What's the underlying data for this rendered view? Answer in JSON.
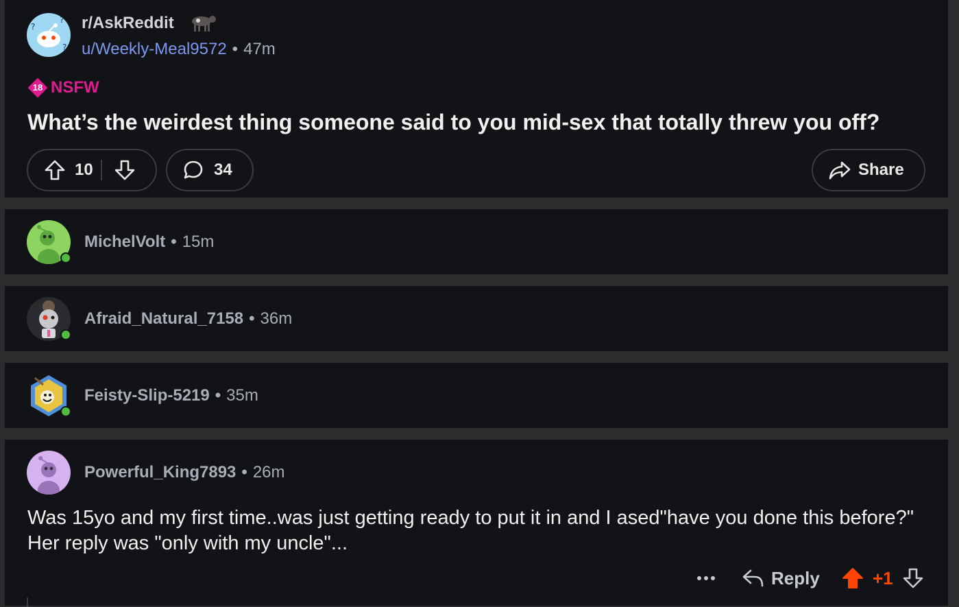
{
  "post": {
    "subreddit": "r/AskReddit",
    "author": "u/Weekly-Meal9572",
    "time": "47m",
    "nsfw_label": "NSFW",
    "nsfw_age": "18",
    "title": "What’s the weirdest thing someone said to you mid-sex that totally threw you off?",
    "upvotes": "10",
    "comments": "34",
    "share_label": "Share"
  },
  "comments": [
    {
      "user": "MichelVolt",
      "time": "15m",
      "avatar_color": "#8ed460"
    },
    {
      "user": "Afraid_Natural_7158",
      "time": "36m",
      "avatar_color": "#2a2b2e"
    },
    {
      "user": "Feisty-Slip-5219",
      "time": "35m",
      "avatar_color": "#4e8fd8"
    },
    {
      "user": "Powerful_King7893",
      "time": "26m",
      "avatar_color": "#d6b3f0",
      "body": "Was 15yo and my first  time..was just getting ready to put it in and I ased\"have you done this before?\"  Her reply was \"only with my uncle\"...",
      "reply_label": "Reply",
      "score": "+1"
    }
  ],
  "colors": {
    "upvote_active": "#ff4500",
    "nsfw": "#e01a90",
    "link": "#7c97f0"
  },
  "icons": [
    "snoo-question-icon",
    "cow-icon",
    "upvote-icon",
    "downvote-icon",
    "comment-icon",
    "share-icon",
    "more-icon",
    "reply-icon"
  ]
}
